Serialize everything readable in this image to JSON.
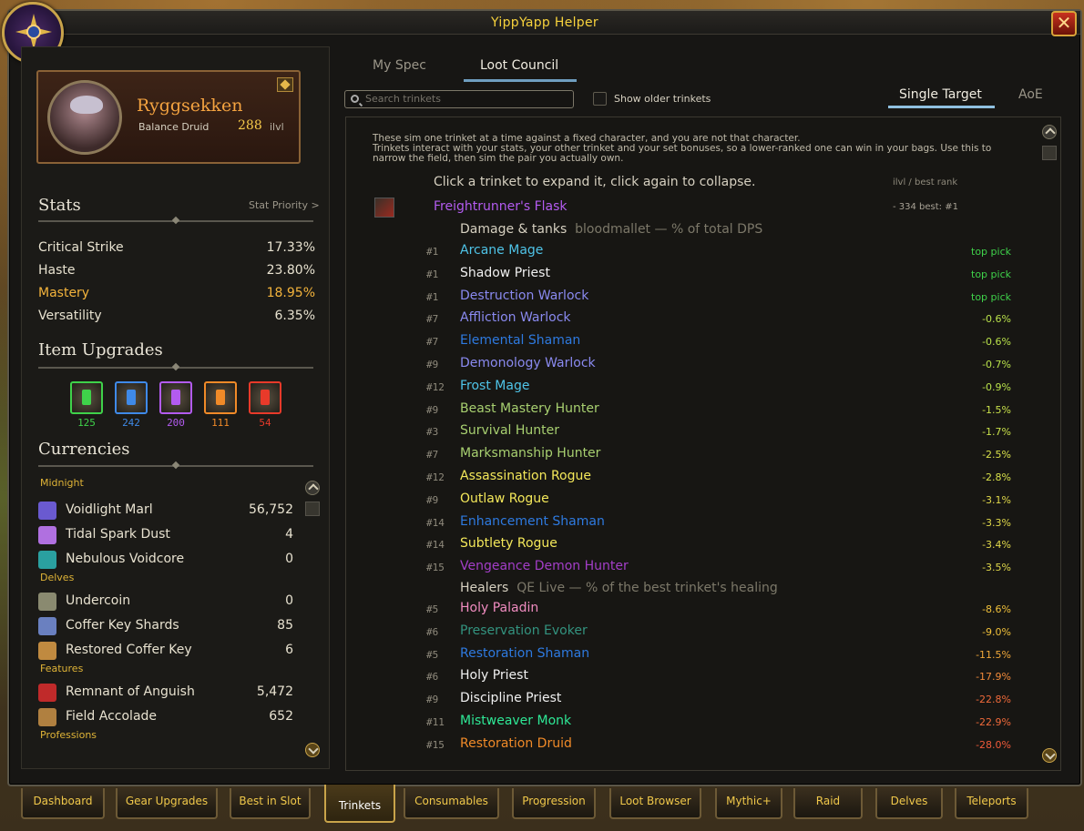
{
  "window": {
    "title": "YippYapp Helper",
    "close_symbol": "✕"
  },
  "character": {
    "name": "Ryggsekken",
    "spec": "Balance Druid",
    "ilvl": "288",
    "ilvl_label": "ilvl"
  },
  "stats": {
    "title": "Stats",
    "priority_link": "Stat Priority >",
    "rows": [
      {
        "name": "Critical Strike",
        "value": "17.33%",
        "color": "#e8e2d0"
      },
      {
        "name": "Haste",
        "value": "23.80%",
        "color": "#e8e2d0"
      },
      {
        "name": "Mastery",
        "value": "18.95%",
        "color": "#f4b43c"
      },
      {
        "name": "Versatility",
        "value": "6.35%",
        "color": "#e8e2d0"
      }
    ]
  },
  "item_upgrades": {
    "title": "Item Upgrades",
    "items": [
      {
        "count": "125",
        "color": "#3fd24a",
        "icon": "upgrade-crest-green-icon"
      },
      {
        "count": "242",
        "color": "#3f8ae8",
        "icon": "upgrade-crest-blue-icon"
      },
      {
        "count": "200",
        "color": "#b35bf0",
        "icon": "upgrade-crest-purple-icon"
      },
      {
        "count": "111",
        "color": "#f08a28",
        "icon": "upgrade-crest-orange-icon"
      },
      {
        "count": "54",
        "color": "#e83a2a",
        "icon": "upgrade-crest-red-icon"
      }
    ]
  },
  "currencies": {
    "title": "Currencies",
    "groups": [
      {
        "name": "Midnight",
        "items": [
          {
            "name": "Voidlight Marl",
            "value": "56,752",
            "icon": "voidlight-marl-icon"
          },
          {
            "name": "Tidal Spark Dust",
            "value": "4",
            "icon": "tidal-spark-dust-icon"
          },
          {
            "name": "Nebulous Voidcore",
            "value": "0",
            "icon": "nebulous-voidcore-icon"
          }
        ]
      },
      {
        "name": "Delves",
        "items": [
          {
            "name": "Undercoin",
            "value": "0",
            "icon": "undercoin-icon"
          },
          {
            "name": "Coffer Key Shards",
            "value": "85",
            "icon": "coffer-key-shards-icon"
          },
          {
            "name": "Restored Coffer Key",
            "value": "6",
            "icon": "restored-coffer-key-icon"
          }
        ]
      },
      {
        "name": "Features",
        "items": [
          {
            "name": "Remnant of Anguish",
            "value": "5,472",
            "icon": "remnant-of-anguish-icon"
          },
          {
            "name": "Field Accolade",
            "value": "652",
            "icon": "field-accolade-icon"
          }
        ]
      },
      {
        "name": "Professions",
        "items": []
      }
    ]
  },
  "top_tabs": [
    {
      "label": "My Spec",
      "active": false
    },
    {
      "label": "Loot Council",
      "active": true
    }
  ],
  "search": {
    "placeholder": "Search trinkets",
    "value": ""
  },
  "toggle": {
    "label": "Show older trinkets",
    "checked": false
  },
  "mode_tabs": [
    {
      "label": "Single Target",
      "active": true
    },
    {
      "label": "AoE",
      "active": false
    }
  ],
  "content": {
    "intro_line1": "These sim one trinket at a time against a fixed character, and you are not that character.",
    "intro_line2": "Trinkets interact with your stats, your other trinket and your set bonuses, so a lower-ranked one can win in your bags. Use this to",
    "intro_line3": "narrow the field, then sim the pair you actually own.",
    "hint": "Click a trinket to expand it, click again to collapse.",
    "column_header": "ilvl / best rank",
    "trinket": {
      "name": "Freightrunner's Flask",
      "meta": "- 334  best: #1"
    },
    "dps_group": {
      "title": "Damage & tanks",
      "sub": "bloodmallet — % of total DPS"
    },
    "healer_group": {
      "title": "Healers",
      "sub": "QE Live — % of the best trinket's healing"
    },
    "dps_rows": [
      {
        "rank": "#1",
        "spec": "Arcane Mage",
        "color": "#4fc4e8",
        "delta": "top pick",
        "dcolor": "#3fd24a"
      },
      {
        "rank": "#1",
        "spec": "Shadow Priest",
        "color": "#f0f0f0",
        "delta": "top pick",
        "dcolor": "#3fd24a"
      },
      {
        "rank": "#1",
        "spec": "Destruction Warlock",
        "color": "#8a8af0",
        "delta": "top pick",
        "dcolor": "#3fd24a"
      },
      {
        "rank": "#7",
        "spec": "Affliction Warlock",
        "color": "#8a8af0",
        "delta": "-0.6%",
        "dcolor": "#b8e04a"
      },
      {
        "rank": "#7",
        "spec": "Elemental Shaman",
        "color": "#2e7ae0",
        "delta": "-0.6%",
        "dcolor": "#b8e04a"
      },
      {
        "rank": "#9",
        "spec": "Demonology Warlock",
        "color": "#8a8af0",
        "delta": "-0.7%",
        "dcolor": "#b8e04a"
      },
      {
        "rank": "#12",
        "spec": "Frost Mage",
        "color": "#4fc4e8",
        "delta": "-0.9%",
        "dcolor": "#b8e04a"
      },
      {
        "rank": "#9",
        "spec": "Beast Mastery Hunter",
        "color": "#a8d070",
        "delta": "-1.5%",
        "dcolor": "#c8e04a"
      },
      {
        "rank": "#3",
        "spec": "Survival Hunter",
        "color": "#a8d070",
        "delta": "-1.7%",
        "dcolor": "#c8e04a"
      },
      {
        "rank": "#7",
        "spec": "Marksmanship Hunter",
        "color": "#a8d070",
        "delta": "-2.5%",
        "dcolor": "#d8e04a"
      },
      {
        "rank": "#12",
        "spec": "Assassination Rogue",
        "color": "#f4e85a",
        "delta": "-2.8%",
        "dcolor": "#d8e04a"
      },
      {
        "rank": "#9",
        "spec": "Outlaw Rogue",
        "color": "#f4e85a",
        "delta": "-3.1%",
        "dcolor": "#e0d84a"
      },
      {
        "rank": "#14",
        "spec": "Enhancement Shaman",
        "color": "#2e7ae0",
        "delta": "-3.3%",
        "dcolor": "#e0d84a"
      },
      {
        "rank": "#14",
        "spec": "Subtlety Rogue",
        "color": "#f4e85a",
        "delta": "-3.4%",
        "dcolor": "#e0d84a"
      },
      {
        "rank": "#15",
        "spec": "Vengeance Demon Hunter",
        "color": "#a33ec8",
        "delta": "-3.5%",
        "dcolor": "#e0d84a"
      }
    ],
    "healer_rows": [
      {
        "rank": "#5",
        "spec": "Holy Paladin",
        "color": "#f08cc0",
        "delta": "-8.6%",
        "dcolor": "#f0c03a"
      },
      {
        "rank": "#6",
        "spec": "Preservation Evoker",
        "color": "#33937f",
        "delta": "-9.0%",
        "dcolor": "#f0c03a"
      },
      {
        "rank": "#5",
        "spec": "Restoration Shaman",
        "color": "#2e7ae0",
        "delta": "-11.5%",
        "dcolor": "#f0a83a"
      },
      {
        "rank": "#6",
        "spec": "Holy Priest",
        "color": "#f0f0f0",
        "delta": "-17.9%",
        "dcolor": "#f08a3a"
      },
      {
        "rank": "#9",
        "spec": "Discipline Priest",
        "color": "#f0f0f0",
        "delta": "-22.8%",
        "dcolor": "#f06a3a"
      },
      {
        "rank": "#11",
        "spec": "Mistweaver Monk",
        "color": "#2ee896",
        "delta": "-22.9%",
        "dcolor": "#f06a3a"
      },
      {
        "rank": "#15",
        "spec": "Restoration Druid",
        "color": "#f08a28",
        "delta": "-28.0%",
        "dcolor": "#f05a3a"
      }
    ]
  },
  "bottom_tabs": [
    {
      "label": "Dashboard",
      "active": false
    },
    {
      "label": "Gear Upgrades",
      "active": false
    },
    {
      "label": "Best in Slot",
      "active": false
    },
    {
      "label": "Trinkets",
      "active": true
    },
    {
      "label": "Consumables",
      "active": false
    },
    {
      "label": "Progression",
      "active": false
    },
    {
      "label": "Loot Browser",
      "active": false
    },
    {
      "label": "Mythic+",
      "active": false
    },
    {
      "label": "Raid",
      "active": false
    },
    {
      "label": "Delves",
      "active": false
    },
    {
      "label": "Teleports",
      "active": false
    }
  ]
}
